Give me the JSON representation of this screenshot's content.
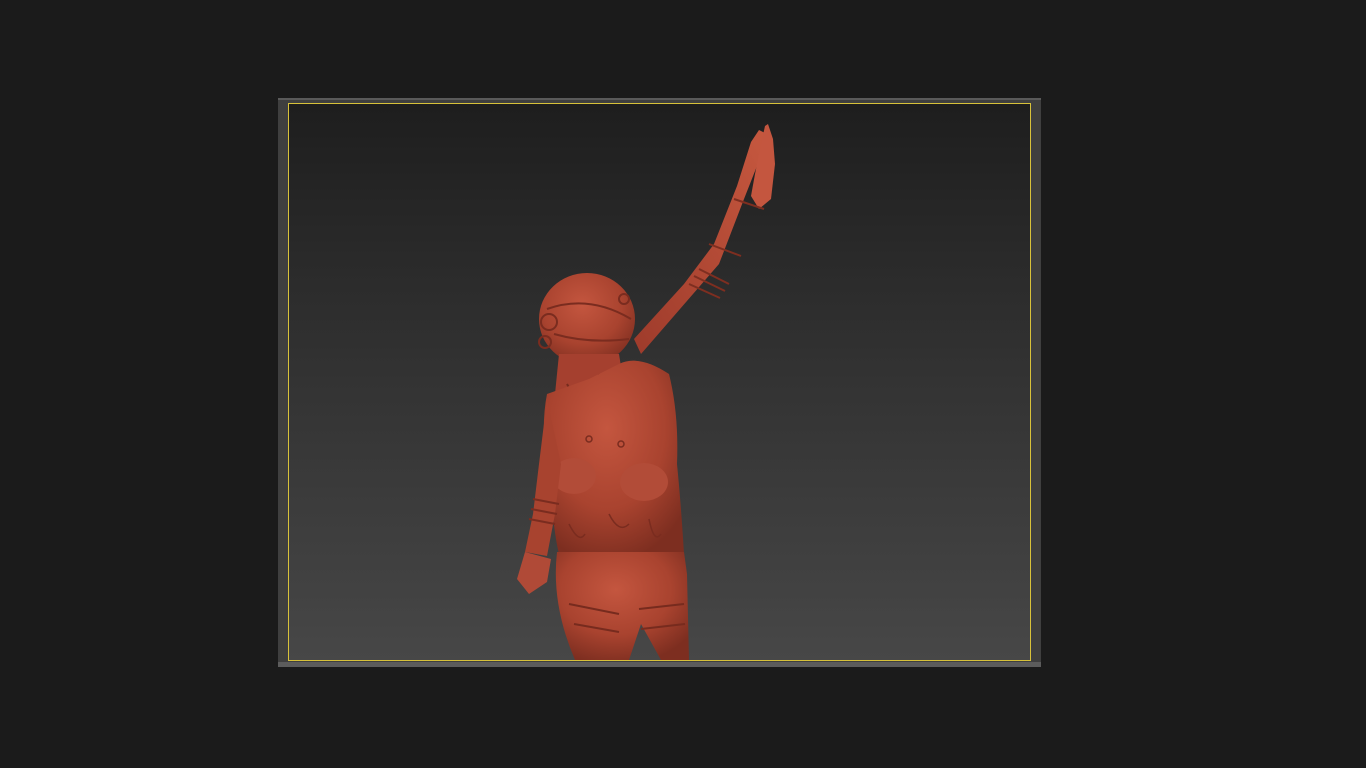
{
  "viewport": {
    "safe_frame_color": "#d8c23a",
    "background_top": "#1e1e1e",
    "background_bottom": "#474747",
    "model": {
      "name": "red-clay-sculpt",
      "color": "#b94a38"
    }
  }
}
